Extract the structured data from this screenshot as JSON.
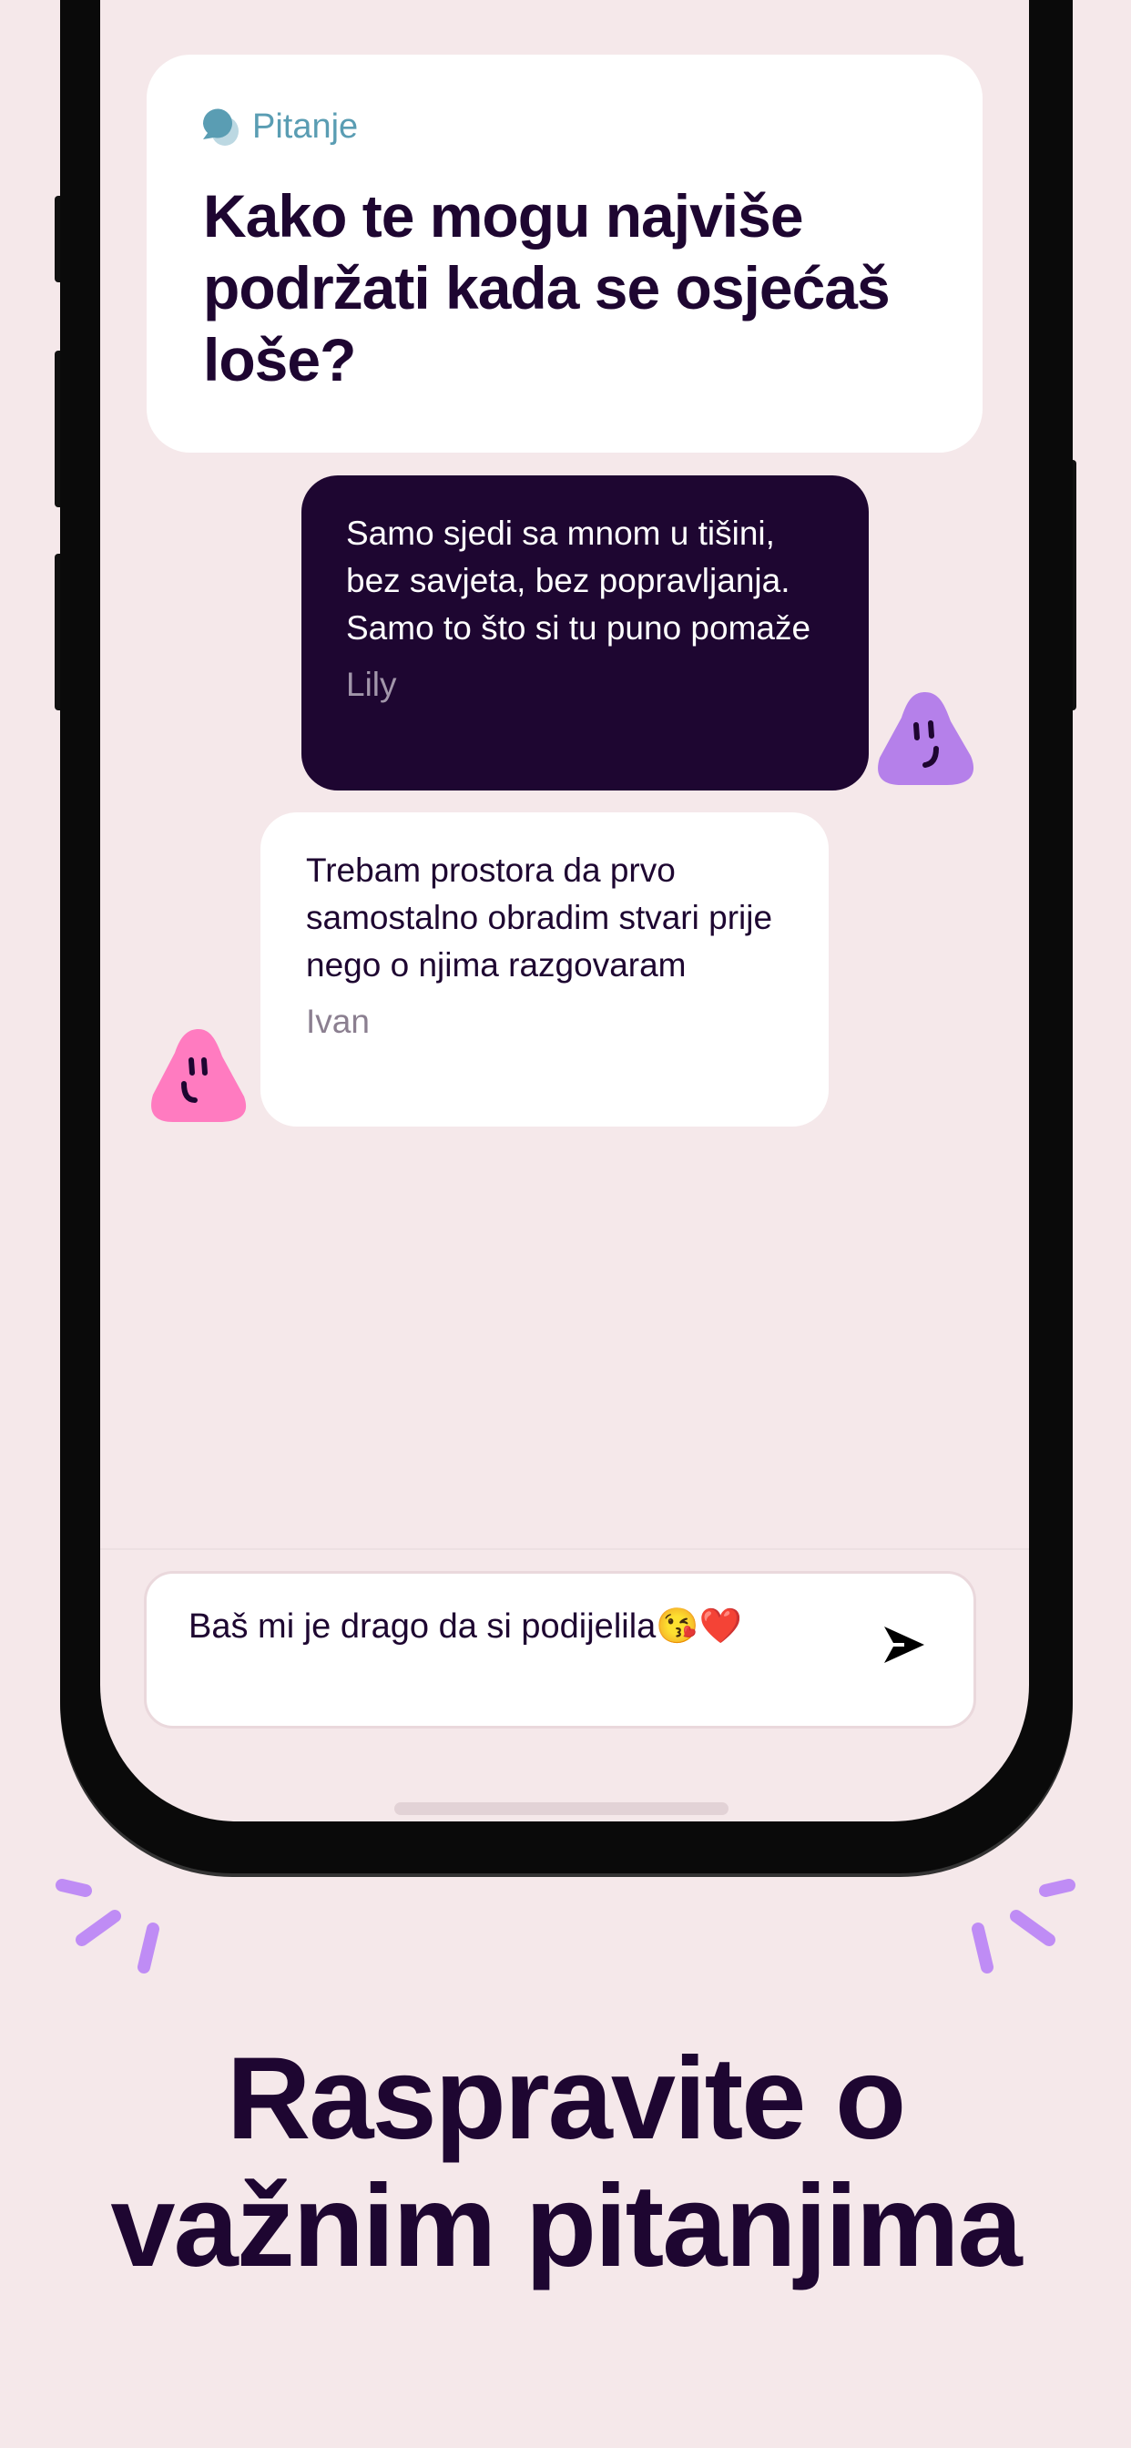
{
  "question_card": {
    "tag_label": "Pitanje",
    "question": "Kako te mogu najviše podržati kada se osjećaš loše?"
  },
  "messages": [
    {
      "text": "Samo sjedi sa mnom u tišini, bez savjeta, bez popravljanja. Samo to što si tu puno pomaže",
      "author": "Lily"
    },
    {
      "text": "Trebam prostora da prvo samostalno obradim stvari prije nego o njima razgovaram",
      "author": "Ivan"
    }
  ],
  "composer": {
    "value": "Baš mi je drago da si podijelila😘❤️"
  },
  "headline": {
    "line1": "Raspravite o",
    "line2": "važnim pitanjima"
  },
  "colors": {
    "background": "#f5e8ea",
    "dark": "#1e0631",
    "accent_teal": "#5a9db3",
    "avatar_purple": "#b580ea",
    "avatar_pink": "#ff7bc0",
    "rays": "#bf8cf5"
  }
}
